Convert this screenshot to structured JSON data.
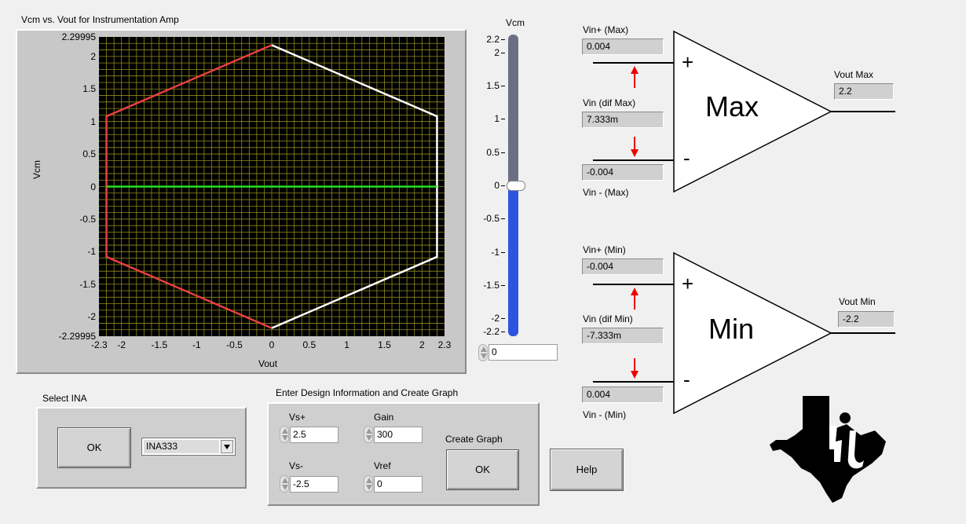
{
  "graph": {
    "title": "Vcm vs. Vout for Instrumentation Amp",
    "xlabel": "Vout",
    "ylabel": "Vcm"
  },
  "chart_data": {
    "type": "line",
    "title": "Vcm vs. Vout for Instrumentation Amp",
    "xlabel": "Vout",
    "ylabel": "Vcm",
    "xlim": [
      -2.3,
      2.3
    ],
    "ylim": [
      -2.29995,
      2.29995
    ],
    "x_ticks": [
      "-2.3",
      "-2",
      "-1.5",
      "-1",
      "-0.5",
      "0",
      "0.5",
      "1",
      "1.5",
      "2",
      "2.3"
    ],
    "y_ticks": [
      "2.29995",
      "2",
      "1.5",
      "1",
      "0.5",
      "0",
      "-0.5",
      "-1",
      "-1.5",
      "-2",
      "-2.29995"
    ],
    "grid": true,
    "series": [
      {
        "color": "#e84040",
        "x": [
          0,
          -2.2,
          -2.2,
          0
        ],
        "y": [
          2.175,
          1.08,
          -1.08,
          -2.175
        ]
      },
      {
        "color": "#ffffff",
        "x": [
          0,
          2.2,
          2.2,
          0
        ],
        "y": [
          2.175,
          1.08,
          -1.08,
          -2.175
        ]
      },
      {
        "color": "#22e022",
        "x": [
          -2.2,
          2.2
        ],
        "y": [
          0,
          0
        ]
      }
    ]
  },
  "slider": {
    "label": "Vcm",
    "min": -2.2,
    "max": 2.2,
    "value": 0,
    "ticks": [
      "2.2",
      "2",
      "1.5",
      "1",
      "0.5",
      "0",
      "-0.5",
      "-1",
      "-1.5",
      "-2",
      "-2.2"
    ],
    "value_display": "0"
  },
  "amp_max": {
    "vin_plus_label": "Vin+ (Max)",
    "vin_plus_value": "0.004",
    "vin_dif_label": "Vin (dif Max)",
    "vin_dif_value": "7.333m",
    "vin_minus_label": "Vin - (Max)",
    "vin_minus_value": "-0.004",
    "amp_text": "Max",
    "plus_sign": "+",
    "minus_sign": "-",
    "vout_label": "Vout Max",
    "vout_value": "2.2"
  },
  "amp_min": {
    "vin_plus_label": "Vin+ (Min)",
    "vin_plus_value": "-0.004",
    "vin_dif_label": "Vin (dif Min)",
    "vin_dif_value": "-7.333m",
    "vin_minus_label": "Vin - (Min)",
    "vin_minus_value": "0.004",
    "amp_text": "Min",
    "plus_sign": "+",
    "minus_sign": "-",
    "vout_label": "Vout Min",
    "vout_value": "-2.2"
  },
  "select_ina": {
    "title": "Select INA",
    "ok_label": "OK",
    "selected": "INA333"
  },
  "design": {
    "title": "Enter Design Information and Create Graph",
    "vs_plus_label": "Vs+",
    "vs_plus_value": "2.5",
    "vs_minus_label": "Vs-",
    "vs_minus_value": "-2.5",
    "gain_label": "Gain",
    "gain_value": "300",
    "vref_label": "Vref",
    "vref_value": "0",
    "create_label": "Create Graph",
    "ok_label": "OK"
  },
  "help_label": "Help",
  "icons": {
    "logo": "ti-texas-logo",
    "arrow": "red-arrow-icon",
    "dropdown": "dropdown-arrow-icon",
    "spinner": "spinner-icon"
  }
}
